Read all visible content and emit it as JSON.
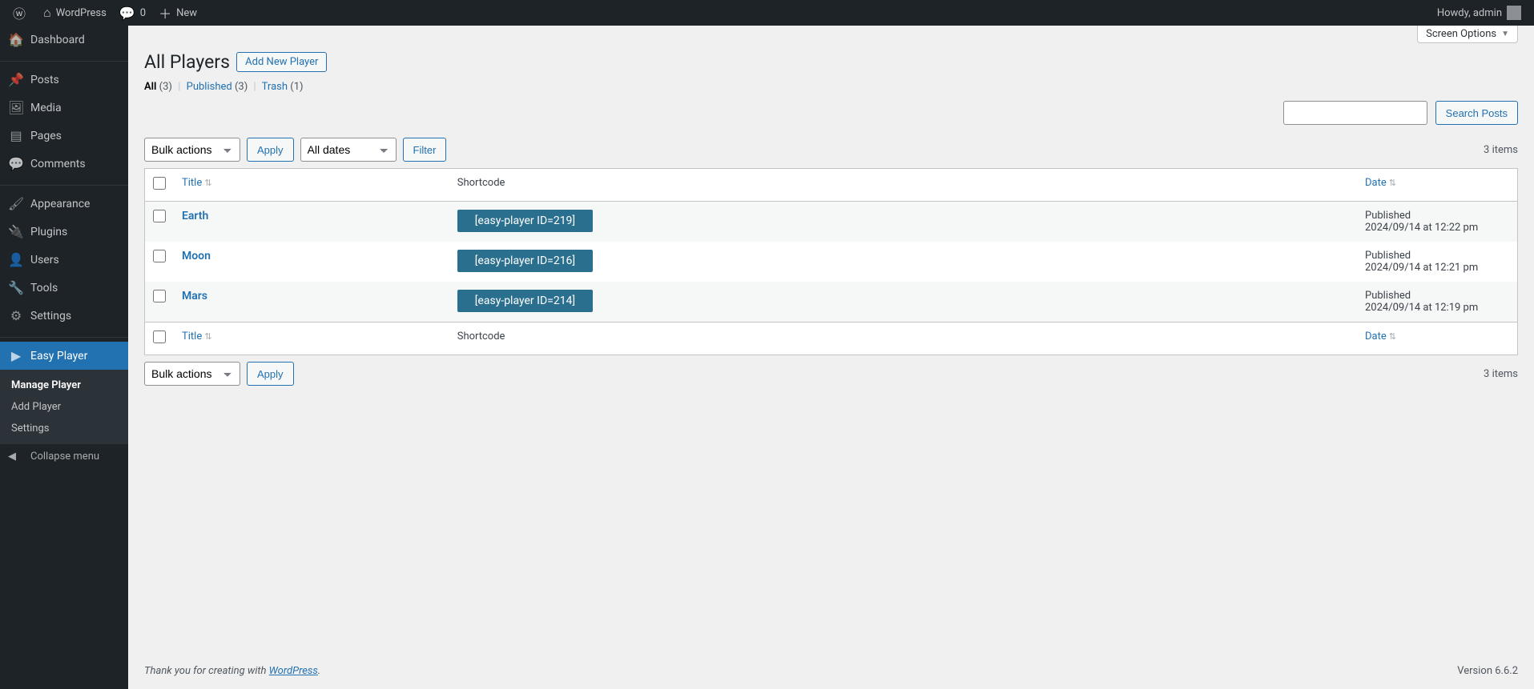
{
  "adminbar": {
    "site_name": "WordPress",
    "comments": "0",
    "new": "New",
    "howdy": "Howdy, admin"
  },
  "sidebar": {
    "dashboard": "Dashboard",
    "posts": "Posts",
    "media": "Media",
    "pages": "Pages",
    "comments": "Comments",
    "appearance": "Appearance",
    "plugins": "Plugins",
    "users": "Users",
    "tools": "Tools",
    "settings": "Settings",
    "easy_player": "Easy Player",
    "submenu": {
      "manage": "Manage Player",
      "add": "Add Player",
      "settings": "Settings"
    },
    "collapse": "Collapse menu"
  },
  "screen_options": "Screen Options",
  "page": {
    "title": "All Players",
    "add_new": "Add New Player"
  },
  "filters": {
    "all": "All",
    "all_count": "(3)",
    "published": "Published",
    "published_count": "(3)",
    "trash": "Trash",
    "trash_count": "(1)"
  },
  "search_button": "Search Posts",
  "bulk": {
    "label": "Bulk actions",
    "apply": "Apply",
    "dates": "All dates",
    "filter": "Filter"
  },
  "count": "3 items",
  "cols": {
    "title": "Title",
    "shortcode": "Shortcode",
    "date": "Date"
  },
  "rows": [
    {
      "title": "Earth",
      "shortcode": "[easy-player ID=219]",
      "status": "Published",
      "date": "2024/09/14 at 12:22 pm"
    },
    {
      "title": "Moon",
      "shortcode": "[easy-player ID=216]",
      "status": "Published",
      "date": "2024/09/14 at 12:21 pm"
    },
    {
      "title": "Mars",
      "shortcode": "[easy-player ID=214]",
      "status": "Published",
      "date": "2024/09/14 at 12:19 pm"
    }
  ],
  "footer": {
    "thanks": "Thank you for creating with ",
    "wp": "WordPress",
    "dot": ".",
    "version": "Version 6.6.2"
  }
}
